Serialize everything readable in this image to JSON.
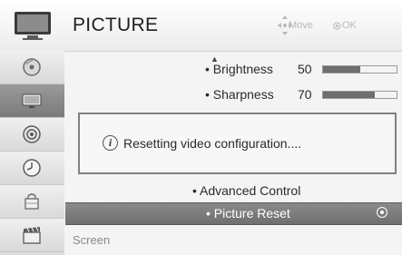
{
  "header": {
    "title": "PICTURE",
    "hint_move": "Move",
    "hint_ok": "OK",
    "icon": "tv-icon"
  },
  "sidebar": {
    "items": [
      {
        "icon": "disc-icon",
        "active": false
      },
      {
        "icon": "tv-screen-icon",
        "active": true
      },
      {
        "icon": "speaker-icon",
        "active": false
      },
      {
        "icon": "clock-icon",
        "active": false
      },
      {
        "icon": "lock-icon",
        "active": false
      },
      {
        "icon": "clapperboard-icon",
        "active": false
      }
    ]
  },
  "settings": {
    "brightness": {
      "label": "• Brightness",
      "value": "50",
      "level": 0.5
    },
    "sharpness": {
      "label": "• Sharpness",
      "value": "70",
      "level": 0.7
    },
    "advanced_control": "• Advanced Control",
    "picture_reset": "• Picture Reset",
    "screen": "Screen"
  },
  "popup": {
    "message": "Resetting video configuration...."
  },
  "colors": {
    "highlight": "#7d7d7d",
    "bar_fill": "#6e6e6e",
    "hint_text": "#b9b9b9"
  }
}
